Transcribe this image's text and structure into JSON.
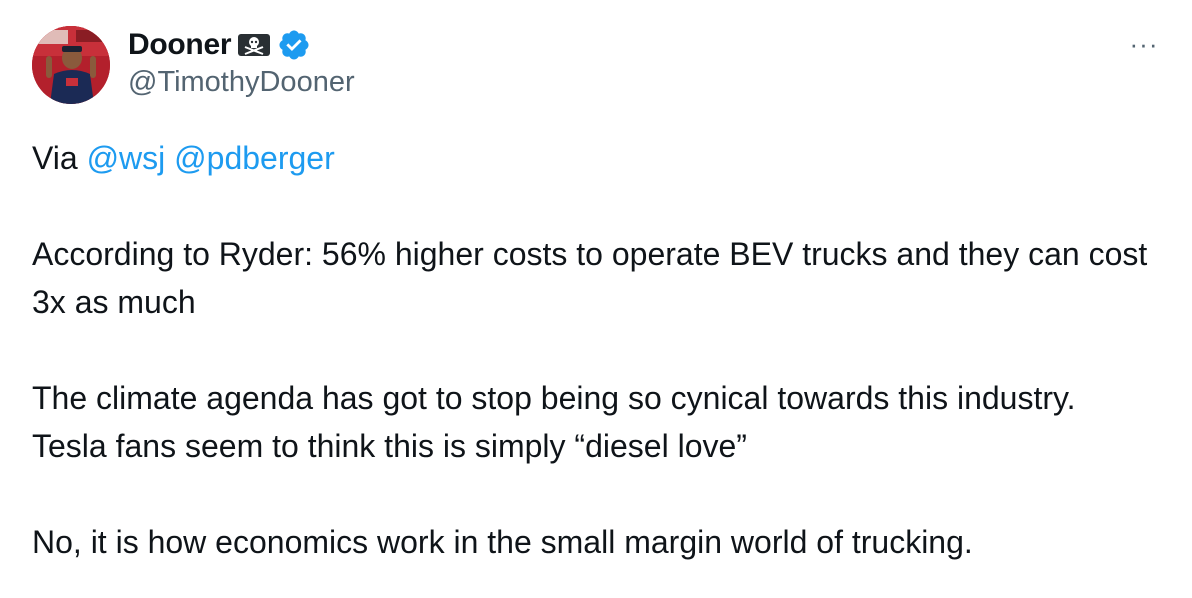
{
  "author": {
    "display_name": "Dooner",
    "handle": "@TimothyDooner",
    "badge_icon": "pirate-flag-icon",
    "verified_icon": "verified-badge-icon",
    "verified_color": "#1d9bf0"
  },
  "menu": {
    "more_label": "···",
    "more_icon": "more-options-icon"
  },
  "tweet": {
    "line1_prefix": "Via ",
    "mention1": "@wsj",
    "mention2": "@pdberger",
    "paragraph2": "According to Ryder: 56% higher costs to operate BEV trucks and they can cost 3x as much",
    "paragraph3": "The climate agenda has got to stop being so cynical towards this industry. Tesla fans seem to think this is simply “diesel love”",
    "paragraph4": "No, it is how economics work in the small margin world of trucking."
  },
  "colors": {
    "text": "#0f1419",
    "secondary": "#536471",
    "link": "#1d9bf0"
  }
}
